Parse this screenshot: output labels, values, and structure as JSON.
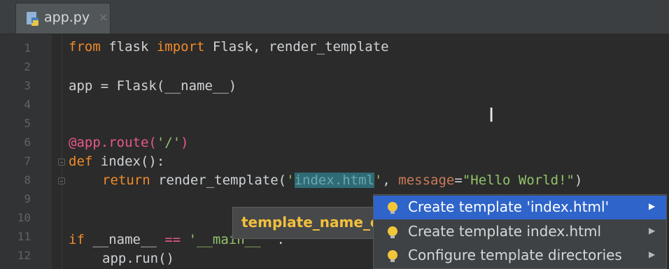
{
  "tab": {
    "title": "app.py",
    "close_glyph": "×"
  },
  "line_numbers": [
    "1",
    "2",
    "3",
    "4",
    "5",
    "6",
    "7",
    "8",
    "9",
    "10",
    "11",
    "12"
  ],
  "code": {
    "l1_kw1": "from",
    "l1_mid": " flask ",
    "l1_kw2": "import",
    "l1_end": " Flask, render_template",
    "l3": "app = Flask(__name__)",
    "l6_dec": "@app.route(",
    "l6_str": "'/'",
    "l6_end": ")",
    "l7_kw": "def",
    "l7_end": " index():",
    "l8_kw": "return",
    "l8_mid": " render_template(",
    "l8_q1": "'",
    "l8_hl": "index.html",
    "l8_q2": "'",
    "l8_comma": ", ",
    "l8_param": "message",
    "l8_eq": "=",
    "l8_str": "\"Hello World!\"",
    "l8_end": ")",
    "l11_kw": "if",
    "l11_mid": " __name__ ",
    "l11_op": "==",
    "l11_str": " '__main__' ",
    "l11_end": ":",
    "l12": "app.run()"
  },
  "tooltip": {
    "text": "template_name_or_list"
  },
  "popup": {
    "items": [
      {
        "label": "Create template 'index.html'"
      },
      {
        "label": "Create template index.html"
      },
      {
        "label": "Configure template directories"
      }
    ],
    "arrow_glyph": "▶"
  },
  "colors": {
    "accent": "#2f65ca",
    "keyword": "#f08b2a",
    "string": "#93c36a",
    "decorator": "#e7598a"
  }
}
